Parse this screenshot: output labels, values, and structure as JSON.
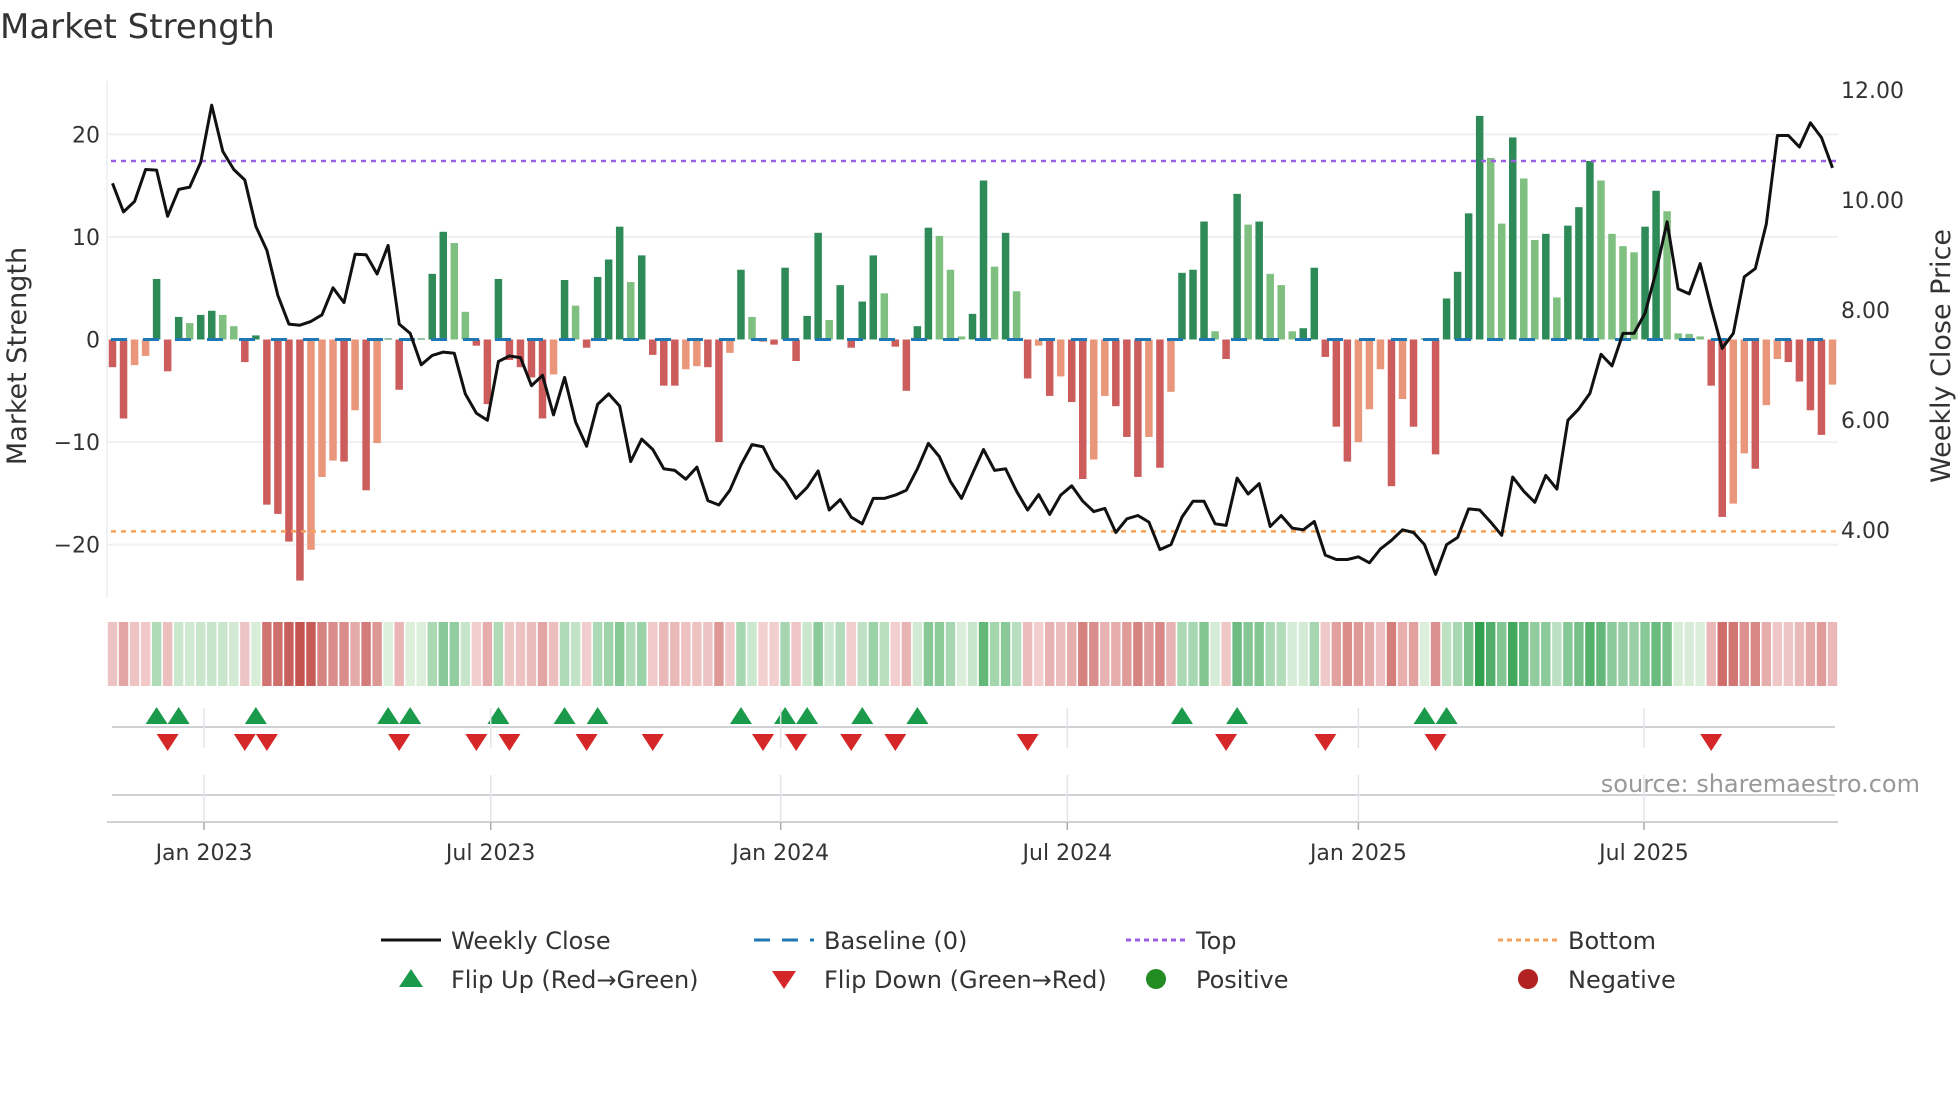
{
  "chart_data": {
    "type": "bar+line",
    "title": "Market Strength",
    "ylabel": "Market Strength",
    "ylabel_right": "Weekly Close Price",
    "ylim": [
      -25.2,
      25.2
    ],
    "ylim_right": [
      2.76,
      12.16
    ],
    "xlim": [
      -0.5,
      156.5
    ],
    "yticks": [
      {
        "v": 20,
        "label": "20"
      },
      {
        "v": 10,
        "label": "10"
      },
      {
        "v": 0,
        "label": "0"
      },
      {
        "v": -10,
        "label": "−10"
      },
      {
        "v": -20,
        "label": "−20"
      }
    ],
    "yticks_right": [
      {
        "v": 12,
        "label": "12.00"
      },
      {
        "v": 10,
        "label": "10.00"
      },
      {
        "v": 8,
        "label": "8.00"
      },
      {
        "v": 6,
        "label": "6.00"
      },
      {
        "v": 4,
        "label": "4.00"
      }
    ],
    "xticks": [
      {
        "v": 8.3,
        "label": "Jan 2023"
      },
      {
        "v": 34.3,
        "label": "Jul 2023"
      },
      {
        "v": 60.6,
        "label": "Jan 2024"
      },
      {
        "v": 86.6,
        "label": "Jul 2024"
      },
      {
        "v": 113,
        "label": "Jan 2025"
      },
      {
        "v": 138.9,
        "label": "Jul 2025"
      }
    ],
    "top_level": 17.4,
    "bottom_level": -18.7,
    "baseline": 0,
    "strength": [
      -2.7,
      -7.7,
      -2.5,
      -1.6,
      5.9,
      -3.1,
      2.2,
      1.6,
      2.4,
      2.8,
      2.4,
      1.3,
      -2.2,
      0.4,
      -16.1,
      -17.0,
      -19.7,
      -23.5,
      -20.5,
      -13.4,
      -11.8,
      -11.9,
      -6.9,
      -14.7,
      -10.1,
      0.1,
      -4.9,
      0.1,
      0.1,
      6.4,
      10.5,
      9.4,
      2.7,
      -0.6,
      -6.3,
      5.9,
      -2.0,
      -2.7,
      -3.7,
      -7.7,
      -3.4,
      5.8,
      3.3,
      -0.8,
      6.1,
      7.8,
      11.0,
      5.6,
      8.2,
      -1.5,
      -4.5,
      -4.5,
      -2.9,
      -2.6,
      -2.7,
      -10.0,
      -1.3,
      6.8,
      2.2,
      -0.2,
      -0.5,
      7.0,
      -2.1,
      2.3,
      10.4,
      1.9,
      5.3,
      -0.8,
      3.7,
      8.2,
      4.5,
      -0.7,
      -5.0,
      1.3,
      10.9,
      10.1,
      6.8,
      0.3,
      2.5,
      15.5,
      7.1,
      10.4,
      4.7,
      -3.8,
      -0.6,
      -5.5,
      -3.6,
      -6.1,
      -13.6,
      -11.7,
      -5.5,
      -6.5,
      -9.5,
      -13.4,
      -9.5,
      -12.5,
      -5.1,
      6.5,
      6.8,
      11.5,
      0.8,
      -1.9,
      14.2,
      11.2,
      11.5,
      6.4,
      5.3,
      0.8,
      1.1,
      7.0,
      -1.7,
      -8.5,
      -11.9,
      -10.0,
      -6.8,
      -2.9,
      -14.3,
      -5.8,
      -8.5,
      0.1,
      -11.2,
      4.0,
      6.6,
      12.3,
      21.8,
      17.7,
      11.3,
      19.7,
      15.7,
      9.7,
      10.3,
      4.1,
      11.1,
      12.9,
      17.4,
      15.5,
      10.3,
      9.1,
      8.5,
      11.0,
      14.5,
      12.5,
      0.6,
      0.55,
      0.3,
      -4.5,
      -17.3,
      -16.0,
      -11.1,
      -12.6,
      -6.4,
      -1.9,
      -2.2,
      -4.1,
      -6.9,
      -9.3,
      -4.4
    ],
    "weekly_close": [
      10.3,
      9.78,
      9.97,
      10.55,
      10.54,
      9.7,
      10.19,
      10.23,
      10.68,
      11.72,
      10.88,
      10.55,
      10.36,
      9.52,
      9.08,
      8.26,
      7.74,
      7.72,
      7.79,
      7.91,
      8.4,
      8.13,
      9.01,
      9.0,
      8.65,
      9.17,
      7.74,
      7.57,
      7.0,
      7.17,
      7.23,
      7.21,
      6.47,
      6.12,
      5.99,
      7.06,
      7.16,
      7.13,
      6.62,
      6.81,
      6.09,
      6.77,
      5.96,
      5.52,
      6.28,
      6.47,
      6.25,
      5.24,
      5.65,
      5.46,
      5.11,
      5.08,
      4.92,
      5.14,
      4.53,
      4.45,
      4.72,
      5.18,
      5.55,
      5.51,
      5.11,
      4.89,
      4.57,
      4.77,
      5.07,
      4.36,
      4.55,
      4.23,
      4.11,
      4.57,
      4.57,
      4.63,
      4.72,
      5.11,
      5.57,
      5.33,
      4.88,
      4.57,
      5.02,
      5.46,
      5.08,
      5.11,
      4.7,
      4.36,
      4.64,
      4.28,
      4.63,
      4.8,
      4.52,
      4.33,
      4.39,
      3.95,
      4.2,
      4.26,
      4.14,
      3.64,
      3.73,
      4.23,
      4.52,
      4.52,
      4.11,
      4.08,
      4.94,
      4.65,
      4.84,
      4.06,
      4.26,
      4.03,
      4.0,
      4.15,
      3.54,
      3.46,
      3.46,
      3.51,
      3.4,
      3.65,
      3.81,
      4.0,
      3.95,
      3.73,
      3.19,
      3.73,
      3.86,
      4.38,
      4.36,
      4.14,
      3.9,
      4.96,
      4.7,
      4.5,
      4.99,
      4.74,
      5.99,
      6.2,
      6.48,
      7.19,
      6.98,
      7.57,
      7.57,
      7.94,
      8.7,
      9.6,
      8.38,
      8.29,
      8.84,
      8.04,
      7.3,
      7.57,
      8.6,
      8.75,
      9.56,
      11.17,
      11.17,
      10.96,
      11.4,
      11.13,
      10.58
    ],
    "legend": {
      "placement": "bottom",
      "items": [
        {
          "label": "Weekly Close",
          "kind": "line"
        },
        {
          "label": "Baseline (0)",
          "kind": "dash"
        },
        {
          "label": "Top",
          "kind": "dot"
        },
        {
          "label": "Bottom",
          "kind": "dot"
        },
        {
          "label": "Flip Up (Red→Green)",
          "kind": "triangle-up"
        },
        {
          "label": "Flip Down (Green→Red)",
          "kind": "triangle-down"
        },
        {
          "label": "Positive",
          "kind": "circle"
        },
        {
          "label": "Negative",
          "kind": "circle"
        }
      ]
    },
    "source": "source: sharemaestro.com"
  },
  "colors": {
    "pos_strong": "#2e8b57",
    "pos_weak": "#7fbf7f",
    "neg_strong": "#cd5c5c",
    "neg_weak": "#e9967a",
    "line": "#111111",
    "baseline": "#1f77b4",
    "top": "#9b5de5",
    "bottom": "#f4a259",
    "flip_up": "#1a9a4a",
    "flip_down": "#d62728",
    "positive": "#228b22",
    "negative": "#b22222"
  }
}
